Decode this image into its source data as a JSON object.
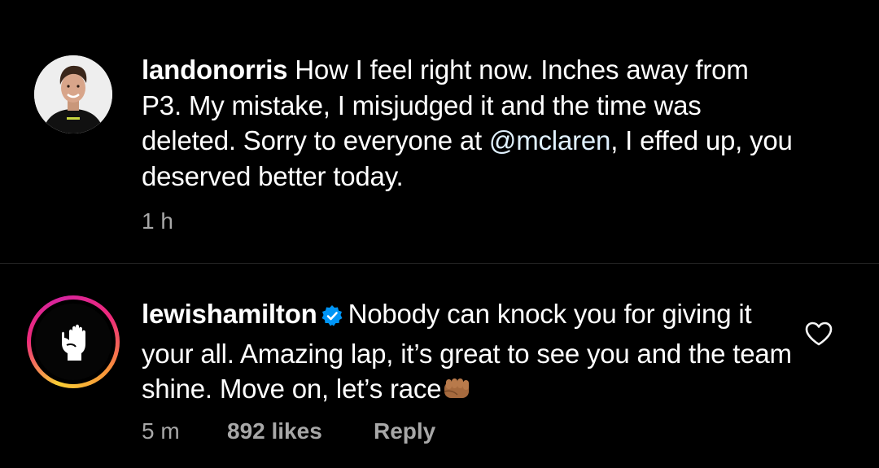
{
  "post": {
    "username": "landonorris",
    "text_before_mention": "How I feel right now. Inches away from P3. My mistake, I misjudged it and the time was deleted. Sorry to everyone at ",
    "mention": "@mclaren",
    "text_after_mention": ", I effed up, you deserved better today.",
    "time": "1 h"
  },
  "comment": {
    "username": "lewishamilton",
    "verified_icon": "verified-badge-icon",
    "text": "Nobody can knock you for giving it your all. Amazing lap, it’s great to see you and the team shine. Move on, let’s race",
    "emoji": "fist-bump-emoji",
    "time": "5 m",
    "likes": "892 likes",
    "reply_label": "Reply",
    "like_icon": "heart-outline-icon"
  },
  "colors": {
    "background": "#000000",
    "text": "#ffffff",
    "secondary_text": "#a8a8a8",
    "mention": "#e0f1ff",
    "verified_blue": "#0095f6",
    "divider": "#262626"
  }
}
